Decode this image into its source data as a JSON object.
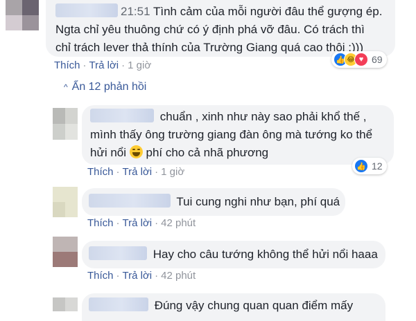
{
  "comments": [
    {
      "time": "21:51",
      "lines": [
        "Tình cảm của mỗi người đâu thể gượng ép.",
        "Ngta chỉ yêu thuông chứ có ý định phá vỡ đâu. Có trách thì",
        "chỉ trách lever thả thính của Trường Giang quá cao thôi :)))"
      ],
      "like": "Thích",
      "reply": "Trả lời",
      "ago": "1 giờ",
      "reaction_count": "69"
    }
  ],
  "hide_replies_label": "Ẩn 12 phản hồi",
  "replies": [
    {
      "line1_after_name": "chuẩn , xinh như này sao phải khổ thế ,",
      "line2": "mình thấy ông trường giang đàn ông mà tướng ko thể",
      "line3_before_emoji": "hửi nổi",
      "line3_after_emoji": "phí cho cả nhã phương",
      "like": "Thích",
      "reply": "Trả lời",
      "ago": "1 giờ",
      "reaction_count": "12"
    },
    {
      "text": "Tui cung nghi như bạn, phí quá",
      "like": "Thích",
      "reply": "Trả lời",
      "ago": "42 phút"
    },
    {
      "text": "Hay cho câu tướng không thể hửi nổi haaa",
      "like": "Thích",
      "reply": "Trả lời",
      "ago": "42 phút"
    },
    {
      "text": "Đúng vậy chung quan quan điểm mấy"
    }
  ],
  "icons": {
    "reaction_like": "like-reaction-icon",
    "reaction_haha": "haha-reaction-icon",
    "reaction_love": "love-reaction-icon",
    "chevron": "chevron-up-icon",
    "emoji": "laughing-emoji-icon"
  },
  "colors": {
    "link": "#385898",
    "bubble": "#f2f3f5",
    "like_blue": "#1877f2",
    "love_red": "#f33e58",
    "haha_yellow": "#ffcc33"
  }
}
